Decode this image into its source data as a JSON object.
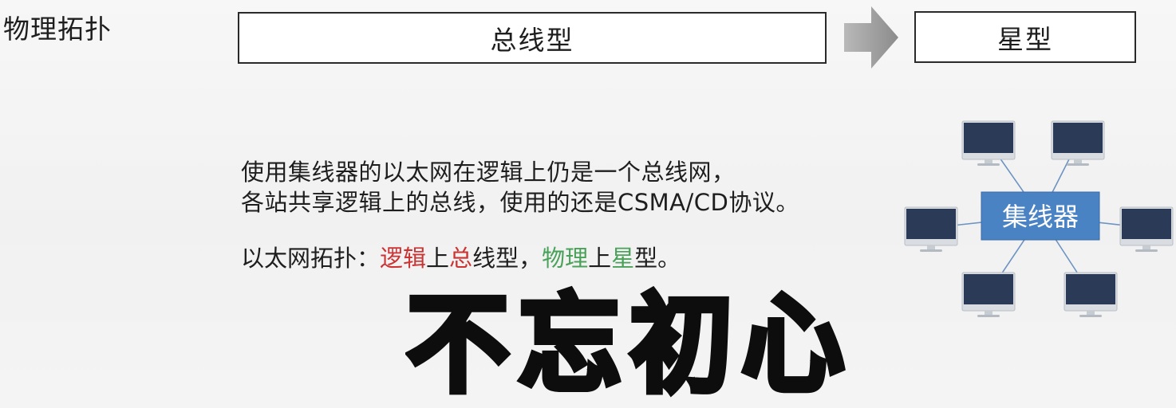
{
  "header": {
    "topology_label": "物理拓扑",
    "bus_label": "总线型",
    "star_label": "星型"
  },
  "description": {
    "line1": "使用集线器的以太网在逻辑上仍是一个总线网，",
    "line2": "各站共享逻辑上的总线，使用的还是CSMA/CD协议。"
  },
  "summary": {
    "prefix": "以太网拓扑：",
    "logic": "逻辑",
    "on1": "上",
    "bus_zong": "总",
    "bus_rest": "线型，",
    "physical": "物理",
    "on2": "上",
    "star_xing": "星",
    "star_rest": "型。"
  },
  "motto": {
    "c1": "不",
    "c2": "忘",
    "c3": "初",
    "c4": "心"
  },
  "diagram": {
    "hub_label": "集线器",
    "hub_color": "#4a83c4",
    "link_color": "#6c93c2",
    "monitor_screen_color": "#2a3a57"
  },
  "colors": {
    "logic_red": "#cc3333",
    "physical_green": "#4aa15a",
    "arrow_gray": "#9a9a9a"
  }
}
